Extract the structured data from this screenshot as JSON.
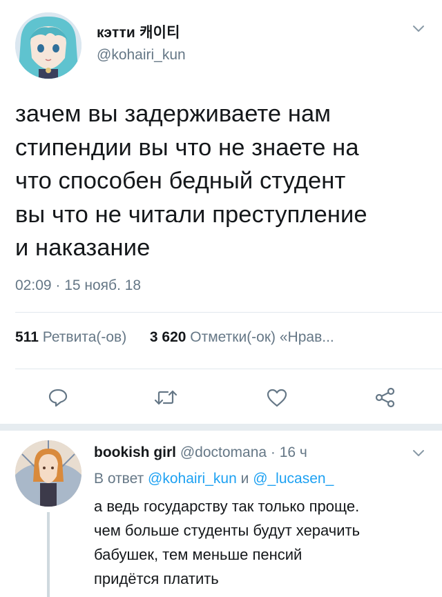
{
  "tweet": {
    "display_name": "кэтти 캐이티",
    "handle": "@kohairi_kun",
    "text_lines": [
      "зачем вы задерживаете нам",
      "стипендии вы что не знаете на",
      "что способен бедный студент",
      "вы что не читали преступление",
      "и наказание"
    ],
    "timestamp": "02:09 · 15 нояб. 18",
    "stats": {
      "retweets": "511",
      "retweets_label": "Ретвита(-ов)",
      "likes": "3 620",
      "likes_label": "Отметки(-ок) «Нрав..."
    },
    "actions": {
      "reply_icon": "reply-icon",
      "retweet_icon": "retweet-icon",
      "like_icon": "heart-icon",
      "share_icon": "share-icon"
    }
  },
  "reply": {
    "display_name": "bookish girl",
    "handle_time": "@doctomana · 16 ч",
    "replying_prefix": "В ответ",
    "mention1": "@kohairi_kun",
    "connector": "и",
    "mention2": "@_lucasen_",
    "text_lines": [
      "а ведь государству так только проще.",
      "чем больше студенты будут херачить",
      "бабушек, тем меньше пенсий",
      "придётся платить"
    ]
  },
  "colors": {
    "text": "#14171a",
    "secondary": "#657786",
    "link": "#1da1f2",
    "divider": "#e1e8ed",
    "separator": "#e6ecf0"
  }
}
